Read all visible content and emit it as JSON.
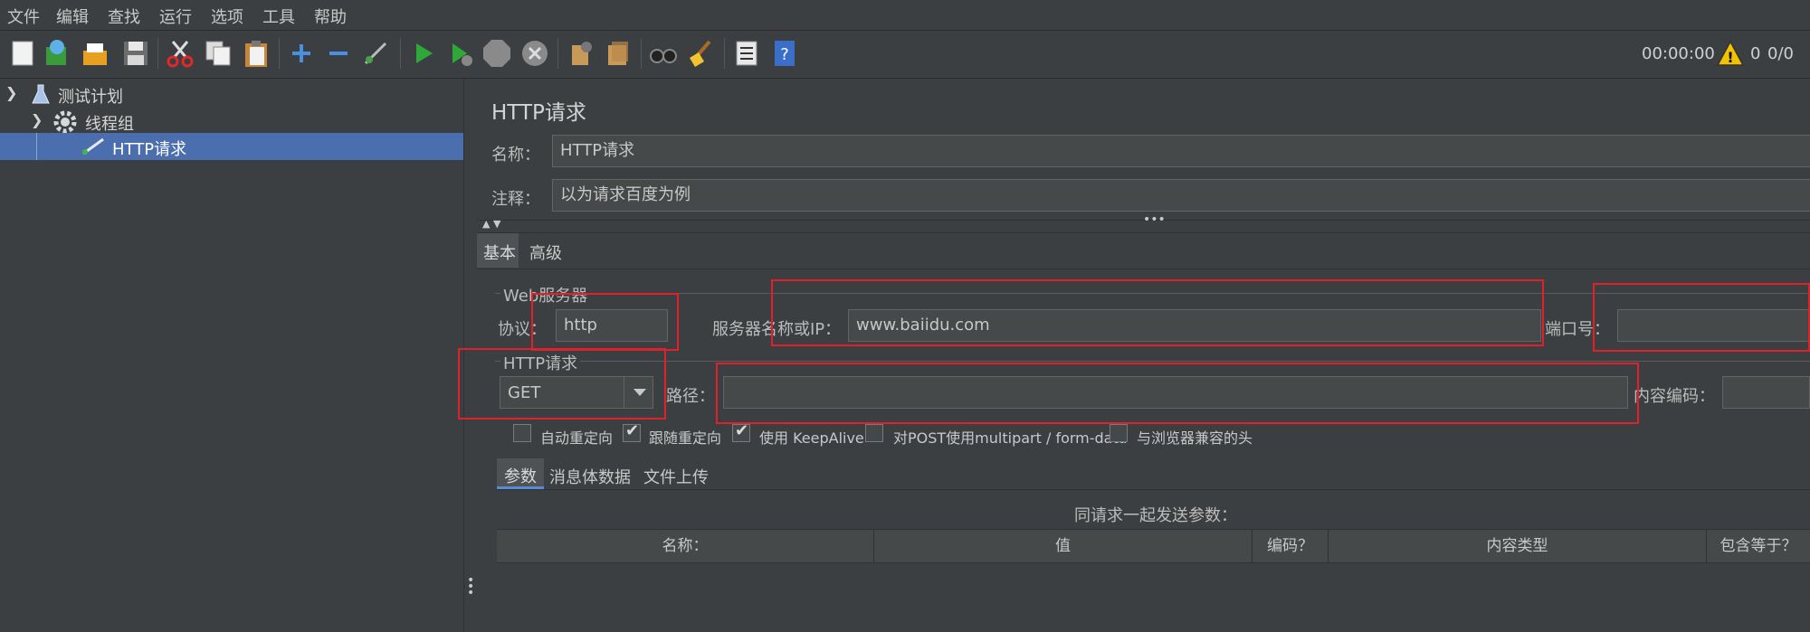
{
  "menu": [
    "文件",
    "编辑",
    "查找",
    "运行",
    "选项",
    "工具",
    "帮助"
  ],
  "toolbar": {
    "icons": [
      "new-icon",
      "templates-icon",
      "open-icon",
      "save-icon",
      "cut-icon",
      "copy-icon",
      "paste-icon",
      "expand-icon",
      "collapse-icon",
      "toggle-icon",
      "start-icon",
      "start-no-pause-icon",
      "stop-icon",
      "shutdown-icon",
      "clear-icon",
      "clear-all-icon",
      "search-icon",
      "reset-search-icon",
      "function-helper-icon",
      "help-icon"
    ],
    "timer": "00:00:00",
    "warning_count": "0",
    "threads": "0/0"
  },
  "tree": {
    "items": [
      {
        "label": "测试计划",
        "icon": "test-plan-icon"
      },
      {
        "label": "线程组",
        "icon": "thread-group-icon"
      },
      {
        "label": "HTTP请求",
        "icon": "sampler-icon"
      }
    ]
  },
  "panel": {
    "title": "HTTP请求",
    "name_label": "名称：",
    "name_value": "HTTP请求",
    "comment_label": "注释：",
    "comment_value": "以为请求百度为例",
    "tabs": [
      "基本",
      "高级"
    ],
    "web_server": {
      "legend": "Web服务器",
      "protocol_label": "协议：",
      "protocol_value": "http",
      "server_label": "服务器名称或IP：",
      "server_value": "www.baiidu.com",
      "port_label": "端口号："
    },
    "http_request": {
      "legend": "HTTP请求",
      "method": "GET",
      "path_label": "路径：",
      "encoding_label": "内容编码："
    },
    "checkboxes": [
      {
        "label": "自动重定向",
        "checked": false
      },
      {
        "label": "跟随重定向",
        "checked": true
      },
      {
        "label": "使用 KeepAlive",
        "checked": true
      },
      {
        "label": "对POST使用multipart / form-data",
        "checked": false
      },
      {
        "label": "与浏览器兼容的头",
        "checked": false
      }
    ],
    "sub_tabs": [
      "参数",
      "消息体数据",
      "文件上传"
    ],
    "params_caption": "同请求一起发送参数：",
    "table_headers": [
      "名称：",
      "值",
      "编码？",
      "内容类型",
      "包含等于？"
    ]
  }
}
